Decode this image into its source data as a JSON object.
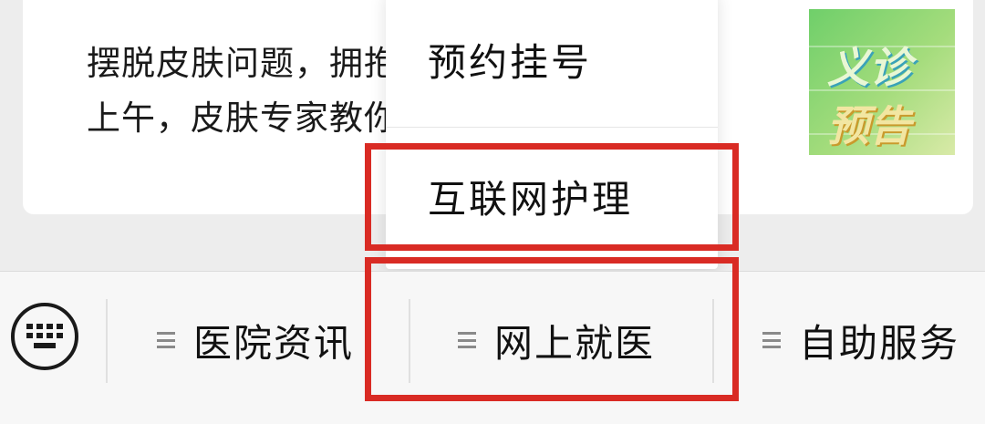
{
  "article": {
    "line1": "摆脱皮肤问题，拥抱...日",
    "line2": "上午，皮肤专家教你...",
    "thumbnail_line1": "义诊",
    "thumbnail_line2": "预告"
  },
  "popup_menu": {
    "items": [
      {
        "label": "预约挂号"
      },
      {
        "label": "互联网护理"
      }
    ]
  },
  "menu_bar": {
    "keyboard_icon": "keyboard-icon",
    "tabs": [
      {
        "label": "医院资讯"
      },
      {
        "label": "网上就医"
      },
      {
        "label": "自助服务"
      }
    ]
  },
  "colors": {
    "highlight": "#d92b24",
    "background": "#ededed",
    "card": "#ffffff"
  }
}
